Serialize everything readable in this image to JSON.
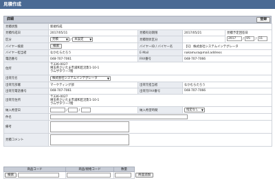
{
  "page": {
    "title": "見積作成"
  },
  "detail": {
    "heading": "詳細",
    "register_label": "登録"
  },
  "form": {
    "status_label": "見積状態",
    "status_value": "新規作成",
    "date_label": "見積作成日",
    "date_value": "2017/05/11",
    "valid_label": "見積有効期限",
    "valid_value": "2017/05/21",
    "answer_label": "見積予定回答日",
    "answer_year": "2017",
    "answer_month": "05",
    "answer_day": "11",
    "category_label": "区分",
    "category_value": "見積",
    "category_sub": "未設定",
    "prod_status_label": "見積現状区分",
    "sales_staff_label": "営業担当者",
    "buyer_search_label": "バイヤー検索",
    "search_button": "検索",
    "buyer_code_label": "バイヤーID / バイヤー名",
    "buyer_code_value": "【1】 株式会社システムインテグレータ",
    "buyer_staff_label": "バイヤー担当者",
    "buyer_staff_value": "なかむらたろう",
    "email_label": "E-Mail",
    "email_value": "nakamura@mail.address",
    "tel_label": "電話番号",
    "tel_value": "048-707-7061",
    "fax_label": "FAX番号",
    "fax_value": "048-707-7066",
    "addr_label": "住所",
    "addr_zip": "〒336-0027",
    "addr_line1": "埼玉県さいたま市浦和区沼影1-10-1",
    "addr_line2": "ラムザタワー7階",
    "ship_name_label": "出荷元名",
    "ship_name_value": "株式会社システムインテグレータ",
    "ship_dept_label": "出荷元部署",
    "ship_dept_value": "マーケティング部",
    "ship_staff_label": "出荷元担当者",
    "ship_staff_value": "なかむらたろう",
    "ship_tel_label": "出荷元電話番号",
    "ship_tel_value": "048-707-7061",
    "ship_fax_label": "出荷元FAX番号",
    "ship_fax_value": "048-707-7066",
    "ship_addr_label": "出荷元住所",
    "ship_zip": "〒336-0027",
    "ship_line1": "埼玉県さいたま市浦和区沼影1-10-1",
    "ship_line2": "ラムザタワー7階",
    "delivery_date_label": "納入希望日",
    "delivery_time_label": "納入希望時間",
    "delivery_time_value": "指定なし",
    "subject_label": "件名",
    "note_label": "備考",
    "comment_label": "見積コメント"
  },
  "items": {
    "col_code": "商品コード",
    "col_name": "商品/規格コード",
    "col_qty": "数量",
    "search_button": "検索",
    "add_button": "商品追加"
  }
}
